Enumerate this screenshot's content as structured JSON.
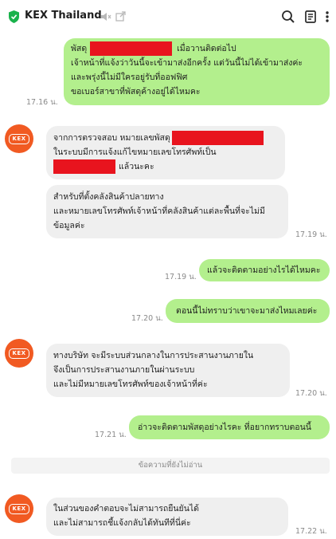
{
  "header": {
    "title": "KEX Thailand",
    "icons": [
      "shield-verified-icon",
      "mute-icon",
      "external-link-icon",
      "search-icon",
      "notes-icon",
      "menu-icon"
    ]
  },
  "avatar_logo": "KEX",
  "colors": {
    "sent_bubble": "#b3ef8d",
    "received_bubble": "#efefef",
    "redaction": "#e8141e",
    "avatar": "#f15a22",
    "verified": "#19b24b"
  },
  "messages": [
    {
      "sender": "me",
      "time": "17.16 น.",
      "l1_pre": "พัสดุ",
      "l1_post": "เมื่อวานติดต่อไป",
      "l2": "เจ้าหน้าที่แจ้งว่าวันนี้จะเข้ามาส่งอีกครั้ง แต่วันนี้ไม่ได้เข้ามาส่งค่ะ",
      "l3": "และพรุ่งนี้ไม่มีใครอยู่รับที่ออฟฟิศ",
      "l4": "ขอเบอร์สาขาที่พัสดุค้างอยู่ได้ไหมคะ"
    },
    {
      "sender": "kex",
      "l1_pre": "จากการตรวจสอบ หมายเลขพัสดุ",
      "l2": "ในระบบมีการแจ้งแก้ไขหมายเลขโทรศัพท์เป็น",
      "l3_post": "แล้วนะคะ"
    },
    {
      "sender": "kex",
      "time": "17.19 น.",
      "l1": "สำหรับที่ตั้งคลังสินค้าปลายทาง",
      "l2": "และหมายเลขโทรศัพท์เจ้าหน้าที่คลังสินค้าแต่ละพื้นที่จะไม่มี",
      "l3": "ข้อมูลค่ะ"
    },
    {
      "sender": "me",
      "time": "17.19 น.",
      "l1": "แล้วจะติดตามอย่างไรได้ไหมคะ"
    },
    {
      "sender": "me",
      "time": "17.20 น.",
      "l1": "ตอนนี้ไม่ทราบว่าเขาจะมาส่งไหมเลยค่ะ"
    },
    {
      "sender": "kex",
      "time": "17.20 น.",
      "l1": "ทางบริษัท จะมีระบบส่วนกลางในการประสานงานภายใน",
      "l2": "จึงเป็นการประสานงานภายในผ่านระบบ",
      "l3": "และไม่มีหมายเลขโทรศัพท์ของเจ้าหน้าที่ค่ะ"
    },
    {
      "sender": "me",
      "time": "17.21 น.",
      "l1": "อ่าวจะติดตามพัสดุอย่างไรคะ ที่อยากทราบตอนนี้"
    },
    {
      "sender": "kex",
      "time": "17.22 น.",
      "l1": "ในส่วนของคำตอบจะไม่สามารถยืนยันได้",
      "l2": "และไม่สามารถชี้แจ้งกลับได้ทันทีที่นี่ค่ะ"
    }
  ],
  "unread_divider": "ข้อความที่ยังไม่อ่าน"
}
